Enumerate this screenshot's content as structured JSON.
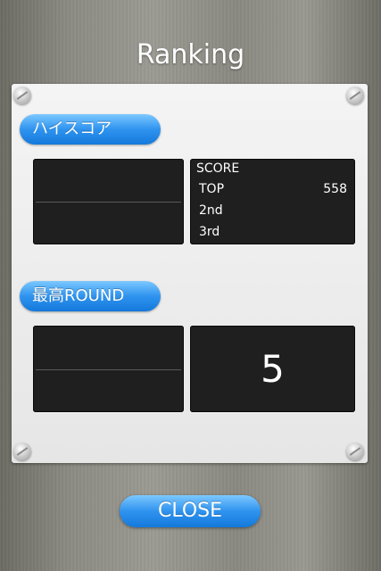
{
  "title": "Ranking",
  "highscore": {
    "label": "ハイスコア",
    "score_header": "SCORE",
    "rows": [
      {
        "rank": "TOP",
        "value": "558"
      },
      {
        "rank": "2nd",
        "value": ""
      },
      {
        "rank": "3rd",
        "value": ""
      }
    ]
  },
  "best_round": {
    "label": "最高ROUND",
    "value": "5"
  },
  "close_label": "CLOSE"
}
